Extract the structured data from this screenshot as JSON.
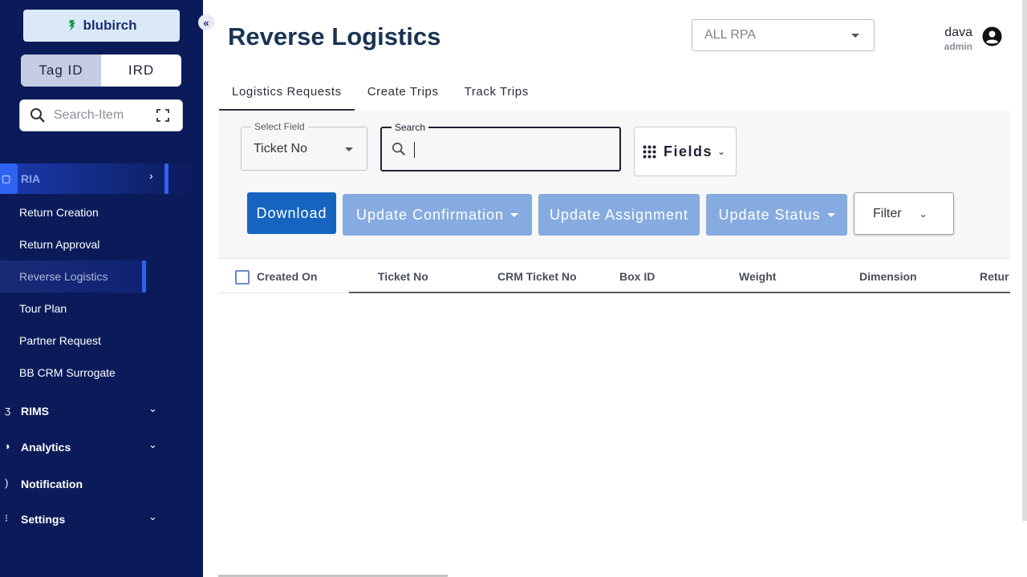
{
  "brand": {
    "name": "blubirch",
    "color": "#1a9a4a"
  },
  "sidebar": {
    "toggle": [
      "Tag ID",
      "IRD"
    ],
    "search_placeholder": "Search-Item",
    "section": "RIA",
    "items": [
      "Return Creation",
      "Return Approval",
      "Reverse Logistics",
      "Tour Plan",
      "Partner Request",
      "BB CRM Surrogate"
    ],
    "active_item": "Reverse Logistics",
    "groups": [
      "RIMS",
      "Analytics",
      "Notification",
      "Settings"
    ]
  },
  "header": {
    "title": "Reverse Logistics",
    "rpa_select": "ALL RPA",
    "user_name": "dava",
    "user_role": "admin"
  },
  "tabs": [
    "Logistics Requests",
    "Create Trips",
    "Track Trips"
  ],
  "filters": {
    "select_field_label": "Select Field",
    "select_field_value": "Ticket No",
    "search_label": "Search",
    "fields_button": "Fields"
  },
  "actions": {
    "download": "Download",
    "update_confirmation": "Update Confirmation",
    "update_assignment": "Update Assignment",
    "update_status": "Update Status",
    "filter": "Filter"
  },
  "table": {
    "columns": [
      "Created On",
      "Ticket No",
      "CRM Ticket No",
      "Box ID",
      "Weight",
      "Dimension",
      "Retur"
    ]
  },
  "colors": {
    "sidebar": "#0b1b5a",
    "primary": "#1565c0",
    "light_primary": "#86abe0",
    "accent": "#2f62f1"
  }
}
